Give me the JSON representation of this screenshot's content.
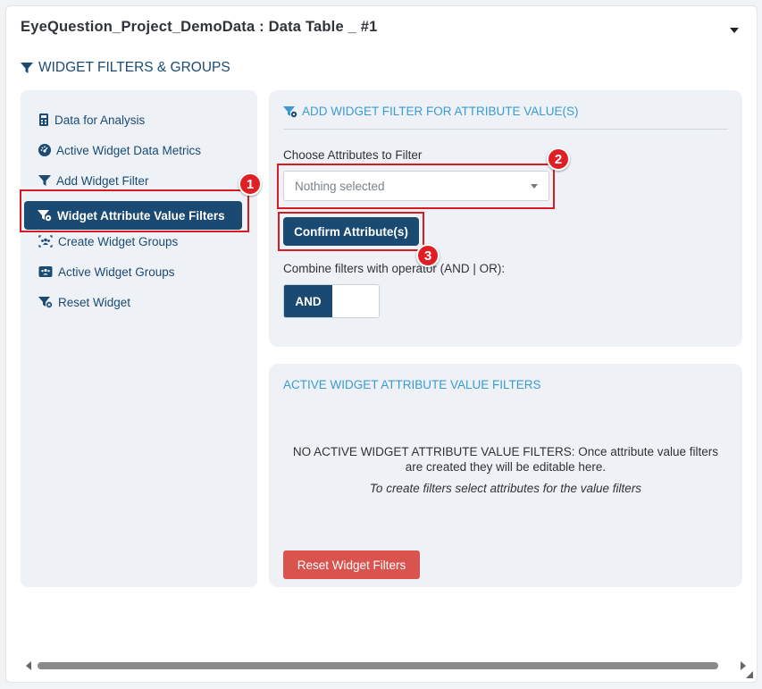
{
  "panel": {
    "title": "EyeQuestion_Project_DemoData : Data Table _ #1"
  },
  "section": {
    "title": "WIDGET FILTERS & GROUPS"
  },
  "sidebar": {
    "items": [
      {
        "label": "Data for Analysis",
        "icon": "calculator-icon"
      },
      {
        "label": "Active Widget Data Metrics",
        "icon": "dashboard-icon"
      },
      {
        "label": "Add Widget Filter",
        "icon": "filter-icon"
      },
      {
        "label": "Widget Attribute Value Filters",
        "icon": "filter-settings-icon",
        "active": true
      },
      {
        "label": "Create Widget Groups",
        "icon": "users-group-icon"
      },
      {
        "label": "Active Widget Groups",
        "icon": "users-card-icon"
      },
      {
        "label": "Reset Widget",
        "icon": "filter-reset-icon"
      }
    ]
  },
  "add_filter": {
    "heading": "ADD WIDGET FILTER FOR ATTRIBUTE VALUE(S)",
    "attributes_label": "Choose Attributes to Filter",
    "attributes_placeholder": "Nothing selected",
    "confirm_label": "Confirm Attribute(s)",
    "operator_label": "Combine filters with operator (AND | OR):",
    "operator_value": "AND"
  },
  "active_filters": {
    "heading": "ACTIVE WIDGET ATTRIBUTE VALUE FILTERS",
    "empty_message": "NO ACTIVE WIDGET ATTRIBUTE VALUE FILTERS: Once attribute value filters are created they will be editable here.",
    "empty_hint": "To create filters select attributes for the value filters",
    "reset_label": "Reset Widget Filters"
  },
  "annotations": [
    "1",
    "2",
    "3"
  ],
  "colors": {
    "primary": "#1a4a72",
    "accent": "#3a9bd1",
    "danger": "#d9534f",
    "annotation": "#e01f25"
  }
}
